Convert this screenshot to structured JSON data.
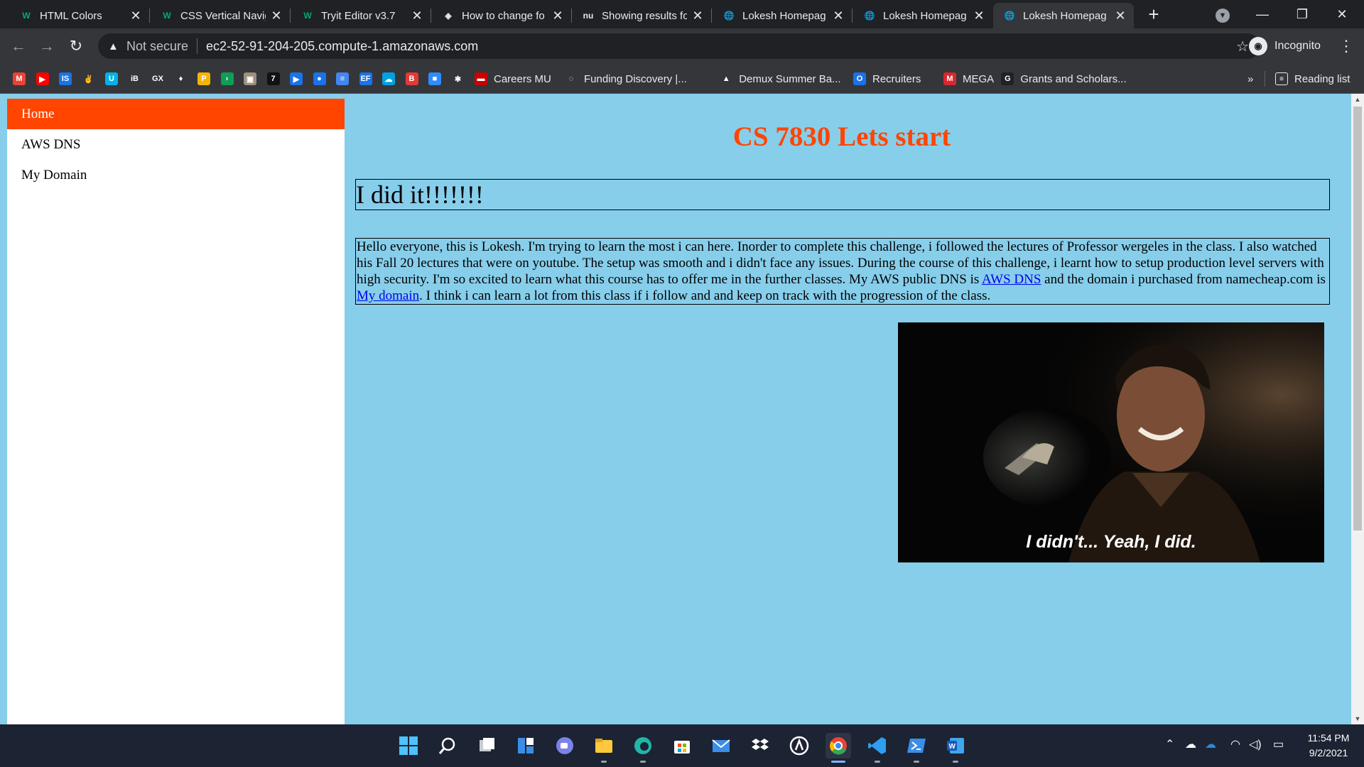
{
  "browser": {
    "tabs": [
      {
        "title": "HTML Colors",
        "favicon": "w3schools-icon",
        "fav_text": "W",
        "fav_color": "#04aa6d",
        "active": false
      },
      {
        "title": "CSS Vertical Navig",
        "favicon": "w3schools-icon",
        "fav_text": "W",
        "fav_color": "#04aa6d",
        "active": false
      },
      {
        "title": "Tryit Editor v3.7",
        "favicon": "w3schools-icon",
        "fav_text": "W",
        "fav_color": "#04aa6d",
        "active": false
      },
      {
        "title": "How to change fo",
        "favicon": "site-icon",
        "fav_text": "◈",
        "fav_color": "#e8eaed",
        "active": false
      },
      {
        "title": "Showing results fo",
        "favicon": "nu-icon",
        "fav_text": "nu",
        "fav_color": "#e8eaed",
        "active": false
      },
      {
        "title": "Lokesh Homepag",
        "favicon": "globe-icon",
        "fav_text": "🌐",
        "fav_color": "#e8eaed",
        "active": false
      },
      {
        "title": "Lokesh Homepag",
        "favicon": "globe-icon",
        "fav_text": "🌐",
        "fav_color": "#e8eaed",
        "active": false
      },
      {
        "title": "Lokesh Homepag",
        "favicon": "globe-icon",
        "fav_text": "🌐",
        "fav_color": "#e8eaed",
        "active": true
      }
    ],
    "security_label": "Not secure",
    "url": "ec2-52-91-204-205.compute-1.amazonaws.com",
    "profile_label": "Incognito",
    "bookmarks": [
      {
        "label": "",
        "icon": "gmail-icon",
        "color": "#ea4335",
        "text": "M"
      },
      {
        "label": "",
        "icon": "youtube-icon",
        "color": "#ff0000",
        "text": "▶"
      },
      {
        "label": "",
        "icon": "is-icon",
        "color": "#1a73e8",
        "text": "IS"
      },
      {
        "label": "",
        "icon": "peace-icon",
        "color": "#35363a",
        "text": "✌"
      },
      {
        "label": "",
        "icon": "udacity-icon",
        "color": "#02b3e4",
        "text": "U"
      },
      {
        "label": "",
        "icon": "ib-icon",
        "color": "#35363a",
        "text": "iB"
      },
      {
        "label": "",
        "icon": "gfx-icon",
        "color": "#35363a",
        "text": "GX"
      },
      {
        "label": "",
        "icon": "leaf-icon",
        "color": "#35363a",
        "text": "♦"
      },
      {
        "label": "",
        "icon": "p-icon",
        "color": "#f4b400",
        "text": "P"
      },
      {
        "label": "",
        "icon": "green-arrow-icon",
        "color": "#0f9d58",
        "text": "›"
      },
      {
        "label": "",
        "icon": "photo-icon",
        "color": "#9e8f7a",
        "text": "▣"
      },
      {
        "label": "",
        "icon": "seven-icon",
        "color": "#111111",
        "text": "7"
      },
      {
        "label": "",
        "icon": "play-icon",
        "color": "#1a73e8",
        "text": "▶"
      },
      {
        "label": "",
        "icon": "circle-icon",
        "color": "#1a73e8",
        "text": "●"
      },
      {
        "label": "",
        "icon": "docs-icon",
        "color": "#4285f4",
        "text": "≡"
      },
      {
        "label": "",
        "icon": "ef-icon",
        "color": "#1a73e8",
        "text": "EF"
      },
      {
        "label": "",
        "icon": "cloud-icon",
        "color": "#00a1e0",
        "text": "☁"
      },
      {
        "label": "",
        "icon": "pdf-icon",
        "color": "#e53935",
        "text": "B"
      },
      {
        "label": "",
        "icon": "zoom-icon",
        "color": "#2d8cff",
        "text": "■"
      },
      {
        "label": "",
        "icon": "star-icon",
        "color": "#35363a",
        "text": "✱"
      },
      {
        "label": "Careers MU",
        "icon": "mu-icon",
        "color": "#cc0000",
        "text": "▬"
      },
      {
        "label": "Funding Discovery |...",
        "icon": "funding-icon",
        "color": "#35363a",
        "text": "◌"
      },
      {
        "label": "Demux Summer Ba...",
        "icon": "drive-icon",
        "color": "#35363a",
        "text": "▲"
      },
      {
        "label": "Recruiters",
        "icon": "recruiters-icon",
        "color": "#1a73e8",
        "text": "O"
      },
      {
        "label": "MEGA",
        "icon": "mega-icon",
        "color": "#d9272e",
        "text": "M"
      },
      {
        "label": "Grants and Scholars...",
        "icon": "google-icon",
        "color": "#202124",
        "text": "G"
      }
    ],
    "overflow_label": "»",
    "reading_list_label": "Reading list"
  },
  "page": {
    "nav": [
      {
        "label": "Home",
        "active": true
      },
      {
        "label": "AWS DNS",
        "active": false
      },
      {
        "label": "My Domain",
        "active": false
      }
    ],
    "title": "CS 7830 Lets start",
    "heading": "I did it!!!!!!!",
    "para_part1": "Hello everyone, this is Lokesh. I'm trying to learn the most i can here. Inorder to complete this challenge, i followed the lectures of Professor wergeles in the class. I also watched his Fall 20 lectures that were on youtube. The setup was smooth and i didn't face any issues. During the course of this challenge, i learnt how to setup production level servers with high security. I'm so excited to learn what this course has to offer me in the further classes. My AWS public DNS is ",
    "link1": "AWS DNS",
    "para_part2": " and the domain i purchased from namecheap.com is ",
    "link2": "My domain",
    "para_part3": ". I think i can learn a lot from this class if i follow and and keep on track with the progression of the class.",
    "gif_caption": "I didn't... Yeah, I did."
  },
  "taskbar": {
    "apps": [
      {
        "name": "start-icon",
        "color": "#4cc2ff"
      },
      {
        "name": "search-icon",
        "color": "#ffffff"
      },
      {
        "name": "task-view-icon",
        "color": "#ffffff"
      },
      {
        "name": "widgets-icon",
        "color": "#3a8ee6"
      },
      {
        "name": "teams-chat-icon",
        "color": "#7b83eb"
      },
      {
        "name": "file-explorer-icon",
        "color": "#ffc83d"
      },
      {
        "name": "edge-icon",
        "color": "#1fb7a6"
      },
      {
        "name": "store-icon",
        "color": "#ffffff"
      },
      {
        "name": "mail-icon",
        "color": "#3a8ee6"
      },
      {
        "name": "dropbox-icon",
        "color": "#ffffff"
      },
      {
        "name": "app-icon",
        "color": "#ffffff"
      },
      {
        "name": "chrome-icon",
        "color": "#34a853"
      },
      {
        "name": "vscode-icon",
        "color": "#2d9ef0"
      },
      {
        "name": "powershell-icon",
        "color": "#3a8ee6"
      },
      {
        "name": "word-icon",
        "color": "#2b7cd3"
      }
    ],
    "time": "11:54 PM",
    "date": "9/2/2021"
  },
  "colors": {
    "page_bg": "#87ceeb",
    "accent": "#ff4500",
    "link": "#0000ee"
  }
}
